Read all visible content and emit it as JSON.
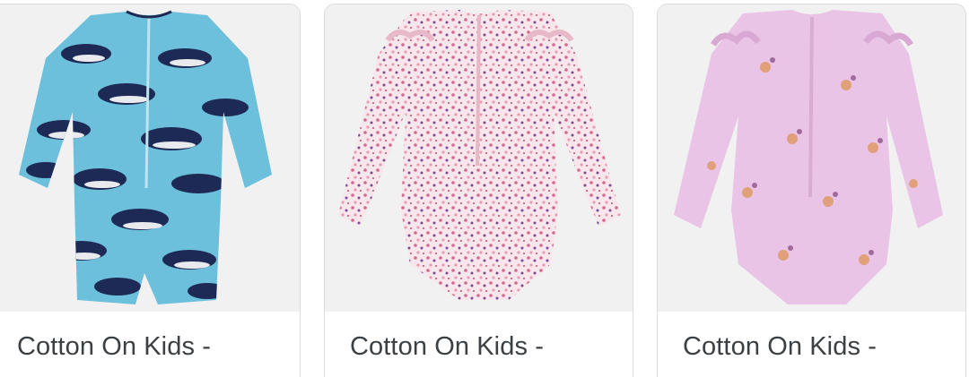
{
  "results": [
    {
      "title": "Cotton On Kids -",
      "image": "blue-whale-print-long-sleeve-swimsuit",
      "colors": {
        "base": "#6cc0dc",
        "print": "#1d2a55",
        "accent": "#ffffff"
      }
    },
    {
      "title": "Cotton On Kids -",
      "image": "pink-ditsy-floral-ruffle-swimsuit",
      "colors": {
        "base": "#f7e7ec",
        "print": "#d36a8c",
        "accent": "#7b4a8f"
      }
    },
    {
      "title": "Cotton On Kids -",
      "image": "lilac-floral-ruffle-swimsuit",
      "colors": {
        "base": "#e9c4e6",
        "print": "#e0a07a",
        "accent": "#a06a9a"
      }
    }
  ]
}
